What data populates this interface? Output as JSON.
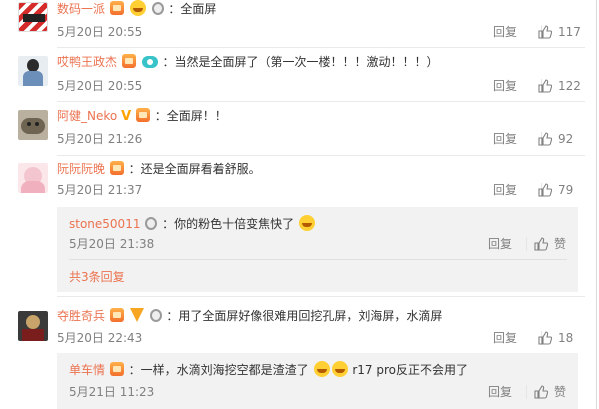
{
  "comments": [
    {
      "username": "数码一派",
      "text": "：全面屏",
      "time": "5月20日 20:55",
      "reply_label": "回复",
      "likes": "117"
    },
    {
      "username": "哎鸭王政杰",
      "text": "：当然是全面屏了（第一次一楼！！！激动！！！）",
      "time": "5月20日 20:55",
      "reply_label": "回复",
      "likes": "122"
    },
    {
      "username": "阿健_Neko",
      "text": "：全面屏！！",
      "time": "5月20日 21:26",
      "reply_label": "回复",
      "likes": "92"
    },
    {
      "username": "阮阮阮晚",
      "text": "：还是全面屏看着舒服。",
      "time": "5月20日 21:37",
      "reply_label": "回复",
      "likes": "79",
      "sub_reply": {
        "username": "stone50011",
        "text": "：你的粉色十倍变焦快了",
        "time": "5月20日 21:38",
        "reply_label": "回复",
        "like_label": "赞",
        "more_label": "共3条回复"
      }
    },
    {
      "username": "夺胜奇兵",
      "text": "：用了全面屏好像很难用回挖孔屏，刘海屏，水滴屏",
      "time": "5月20日 22:43",
      "reply_label": "回复",
      "likes": "18",
      "sub_reply": {
        "username": "单车情",
        "text_a": "：一样，水滴刘海挖空都是渣渣了",
        "text_b": "r17 pro反正不会用了",
        "time": "5月21日 11:23",
        "reply_label": "回复",
        "like_label": "赞"
      }
    }
  ],
  "avatar_colors": [
    "#d62b2b",
    "#6b8fb8",
    "#8c7a5a",
    "#f3c6cf",
    "#3a3a3a"
  ],
  "icons": [
    "vip-icon",
    "emoji-icon",
    "medal-icon",
    "like-thumb-icon",
    "eye-icon",
    "pizza-icon"
  ]
}
